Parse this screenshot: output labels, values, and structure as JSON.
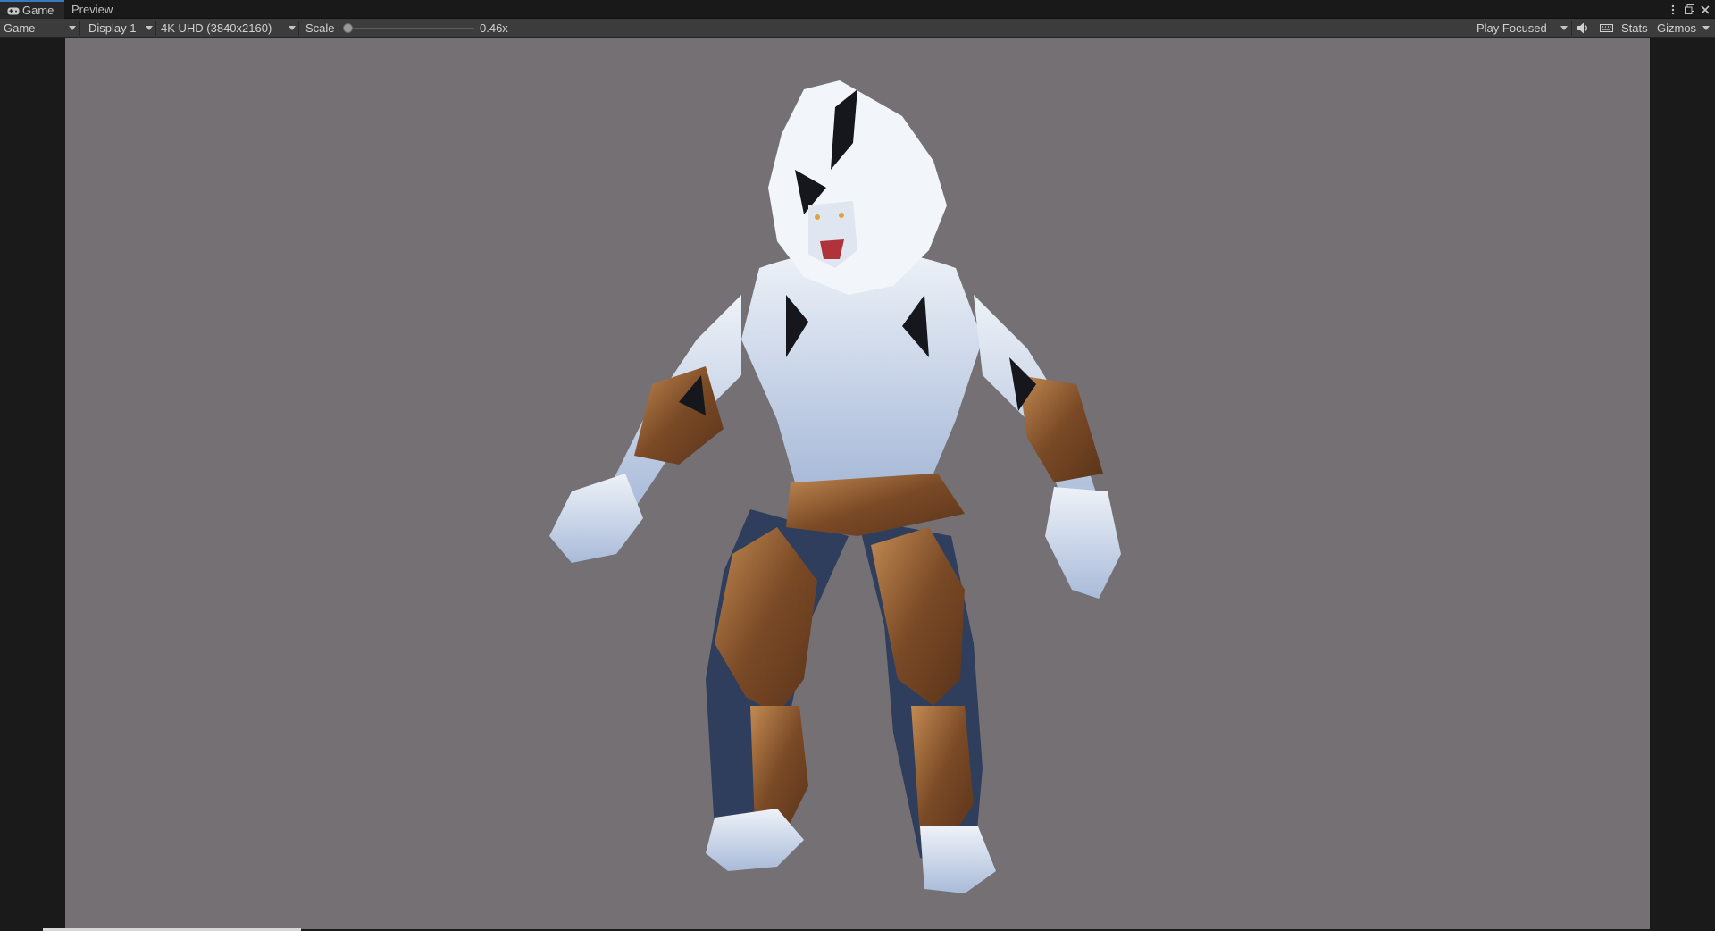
{
  "tabs": [
    {
      "label": "Game",
      "icon": "gamepad-icon",
      "active": true
    },
    {
      "label": "Preview",
      "active": false
    }
  ],
  "window_controls": {
    "menu_icon": "kebab-menu-icon",
    "maximize_icon": "maximize-icon",
    "close_icon": "close-icon"
  },
  "toolbar": {
    "view_mode": "Game",
    "display": "Display 1",
    "resolution": "4K UHD (3840x2160)",
    "scale_label": "Scale",
    "scale_value": "0.46x",
    "scale_fraction": 0.0,
    "play_mode": "Play Focused",
    "audio_icon": "speaker-icon",
    "stats_icon": "keyboard-icon",
    "stats_label": "Stats",
    "gizmos_label": "Gizmos"
  },
  "colors": {
    "accent": "#3a79bb",
    "canvas_bg": "#747074",
    "toolbar_bg": "#3c3c3c"
  },
  "scene": {
    "subject": "werewolf-character-model"
  }
}
